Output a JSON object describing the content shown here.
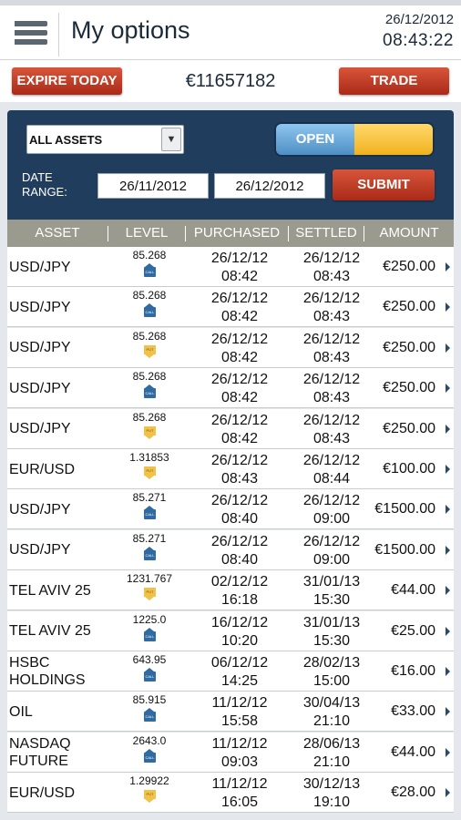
{
  "header": {
    "title": "My options",
    "date": "26/12/2012",
    "time": "08:43:22"
  },
  "toolbar": {
    "expire_label": "EXPIRE TODAY",
    "balance": "€11657182",
    "trade_label": "TRADE"
  },
  "filters": {
    "asset_select": "ALL ASSETS",
    "toggle_label": "OPEN",
    "date_range_label": "DATE RANGE:",
    "date_from": "26/11/2012",
    "date_to": "26/12/2012",
    "submit_label": "SUBMIT"
  },
  "table": {
    "columns": [
      "ASSET",
      "LEVEL",
      "PURCHASED",
      "SETTLED",
      "AMOUNT"
    ],
    "rows": [
      {
        "asset": "USD/JPY",
        "level": "85.268",
        "direction": "call",
        "purchased_date": "26/12/12",
        "purchased_time": "08:42",
        "settled_date": "26/12/12",
        "settled_time": "08:43",
        "amount": "€250.00"
      },
      {
        "asset": "USD/JPY",
        "level": "85.268",
        "direction": "call",
        "purchased_date": "26/12/12",
        "purchased_time": "08:42",
        "settled_date": "26/12/12",
        "settled_time": "08:43",
        "amount": "€250.00"
      },
      {
        "asset": "USD/JPY",
        "level": "85.268",
        "direction": "put",
        "purchased_date": "26/12/12",
        "purchased_time": "08:42",
        "settled_date": "26/12/12",
        "settled_time": "08:43",
        "amount": "€250.00"
      },
      {
        "asset": "USD/JPY",
        "level": "85.268",
        "direction": "call",
        "purchased_date": "26/12/12",
        "purchased_time": "08:42",
        "settled_date": "26/12/12",
        "settled_time": "08:43",
        "amount": "€250.00"
      },
      {
        "asset": "USD/JPY",
        "level": "85.268",
        "direction": "put",
        "purchased_date": "26/12/12",
        "purchased_time": "08:42",
        "settled_date": "26/12/12",
        "settled_time": "08:43",
        "amount": "€250.00"
      },
      {
        "asset": "EUR/USD",
        "level": "1.31853",
        "direction": "put",
        "purchased_date": "26/12/12",
        "purchased_time": "08:43",
        "settled_date": "26/12/12",
        "settled_time": "08:44",
        "amount": "€100.00"
      },
      {
        "asset": "USD/JPY",
        "level": "85.271",
        "direction": "call",
        "purchased_date": "26/12/12",
        "purchased_time": "08:40",
        "settled_date": "26/12/12",
        "settled_time": "09:00",
        "amount": "€1500.00"
      },
      {
        "asset": "USD/JPY",
        "level": "85.271",
        "direction": "call",
        "purchased_date": "26/12/12",
        "purchased_time": "08:40",
        "settled_date": "26/12/12",
        "settled_time": "09:00",
        "amount": "€1500.00"
      },
      {
        "asset": "TEL AVIV 25",
        "level": "1231.767",
        "direction": "put",
        "purchased_date": "02/12/12",
        "purchased_time": "16:18",
        "settled_date": "31/01/13",
        "settled_time": "15:30",
        "amount": "€44.00"
      },
      {
        "asset": "TEL AVIV 25",
        "level": "1225.0",
        "direction": "call",
        "purchased_date": "16/12/12",
        "purchased_time": "10:20",
        "settled_date": "31/01/13",
        "settled_time": "15:30",
        "amount": "€25.00"
      },
      {
        "asset": "HSBC HOLDINGS",
        "level": "643.95",
        "direction": "call",
        "purchased_date": "06/12/12",
        "purchased_time": "14:25",
        "settled_date": "28/02/13",
        "settled_time": "15:00",
        "amount": "€16.00"
      },
      {
        "asset": "OIL",
        "level": "85.915",
        "direction": "call",
        "purchased_date": "11/12/12",
        "purchased_time": "15:58",
        "settled_date": "30/04/13",
        "settled_time": "21:10",
        "amount": "€33.00"
      },
      {
        "asset": "NASDAQ FUTURE",
        "level": "2643.0",
        "direction": "call",
        "purchased_date": "11/12/12",
        "purchased_time": "09:03",
        "settled_date": "28/06/13",
        "settled_time": "21:10",
        "amount": "€44.00"
      },
      {
        "asset": "EUR/USD",
        "level": "1.29922",
        "direction": "put",
        "purchased_date": "11/12/12",
        "purchased_time": "16:05",
        "settled_date": "30/12/13",
        "settled_time": "19:10",
        "amount": "€28.00"
      }
    ]
  },
  "icons": {
    "menu": "hamburger-menu-icon",
    "dropdown": "chevron-down-icon",
    "row_arrow": "chevron-right-icon",
    "call": "call-up-arrow-icon",
    "put": "put-down-arrow-icon"
  },
  "colors": {
    "panel": "#203d5d",
    "button_red": "#b83a22",
    "toggle_blue": "#5e9fd2",
    "toggle_yellow": "#f4c03a",
    "call_badge": "#2f6aa0",
    "put_badge": "#f1c24a",
    "table_header": "#9a9a8e"
  }
}
